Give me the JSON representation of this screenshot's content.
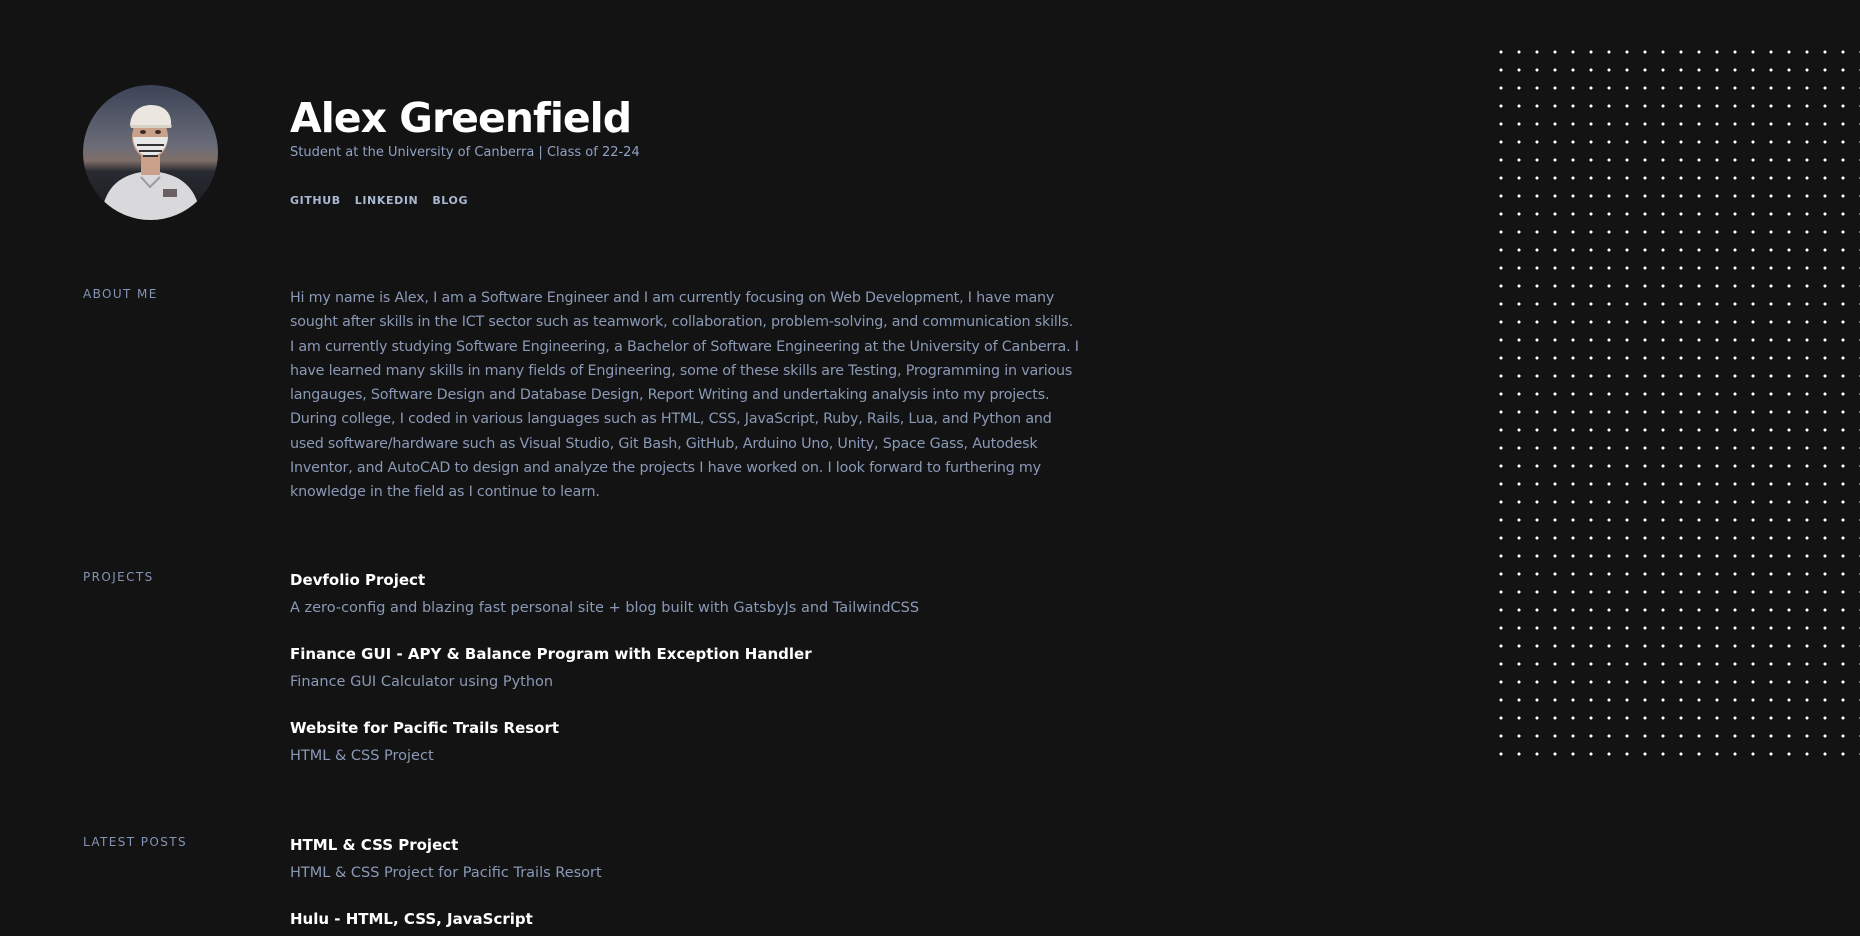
{
  "profile": {
    "name": "Alex Greenfield",
    "tagline": "Student at the University of Canberra | Class of 22-24"
  },
  "links": [
    {
      "label": "GITHUB"
    },
    {
      "label": "LINKEDIN"
    },
    {
      "label": "BLOG"
    }
  ],
  "about": {
    "heading": "ABOUT ME",
    "text": "Hi my name is Alex, I am a Software Engineer and I am currently focusing on Web Development, I have many sought after skills in the ICT sector such as teamwork, collaboration, problem-solving, and communication skills. I am currently studying Software Engineering, a Bachelor of Software Engineering at the University of Canberra. I have learned many skills in many fields of Engineering, some of these skills are Testing, Programming in various langauges, Software Design and Database Design, Report Writing and undertaking analysis into my projects. During college, I coded in various languages such as HTML, CSS, JavaScript, Ruby, Rails, Lua, and Python and used software/hardware such as Visual Studio, Git Bash, GitHub, Arduino Uno, Unity, Space Gass, Autodesk Inventor, and AutoCAD to design and analyze the projects I have worked on. I look forward to furthering my knowledge in the field as I continue to learn."
  },
  "projects": {
    "heading": "PROJECTS",
    "items": [
      {
        "title": "Devfolio Project",
        "description": "A zero-config and blazing fast personal site + blog built with GatsbyJs and TailwindCSS"
      },
      {
        "title": "Finance GUI - APY & Balance Program with Exception Handler",
        "description": "Finance GUI Calculator using Python"
      },
      {
        "title": "Website for Pacific Trails Resort",
        "description": "HTML & CSS Project"
      }
    ]
  },
  "posts": {
    "heading": "LATEST POSTS",
    "items": [
      {
        "title": "HTML & CSS Project",
        "description": "HTML & CSS Project for Pacific Trails Resort"
      },
      {
        "title": "Hulu - HTML, CSS, JavaScript"
      }
    ]
  }
}
